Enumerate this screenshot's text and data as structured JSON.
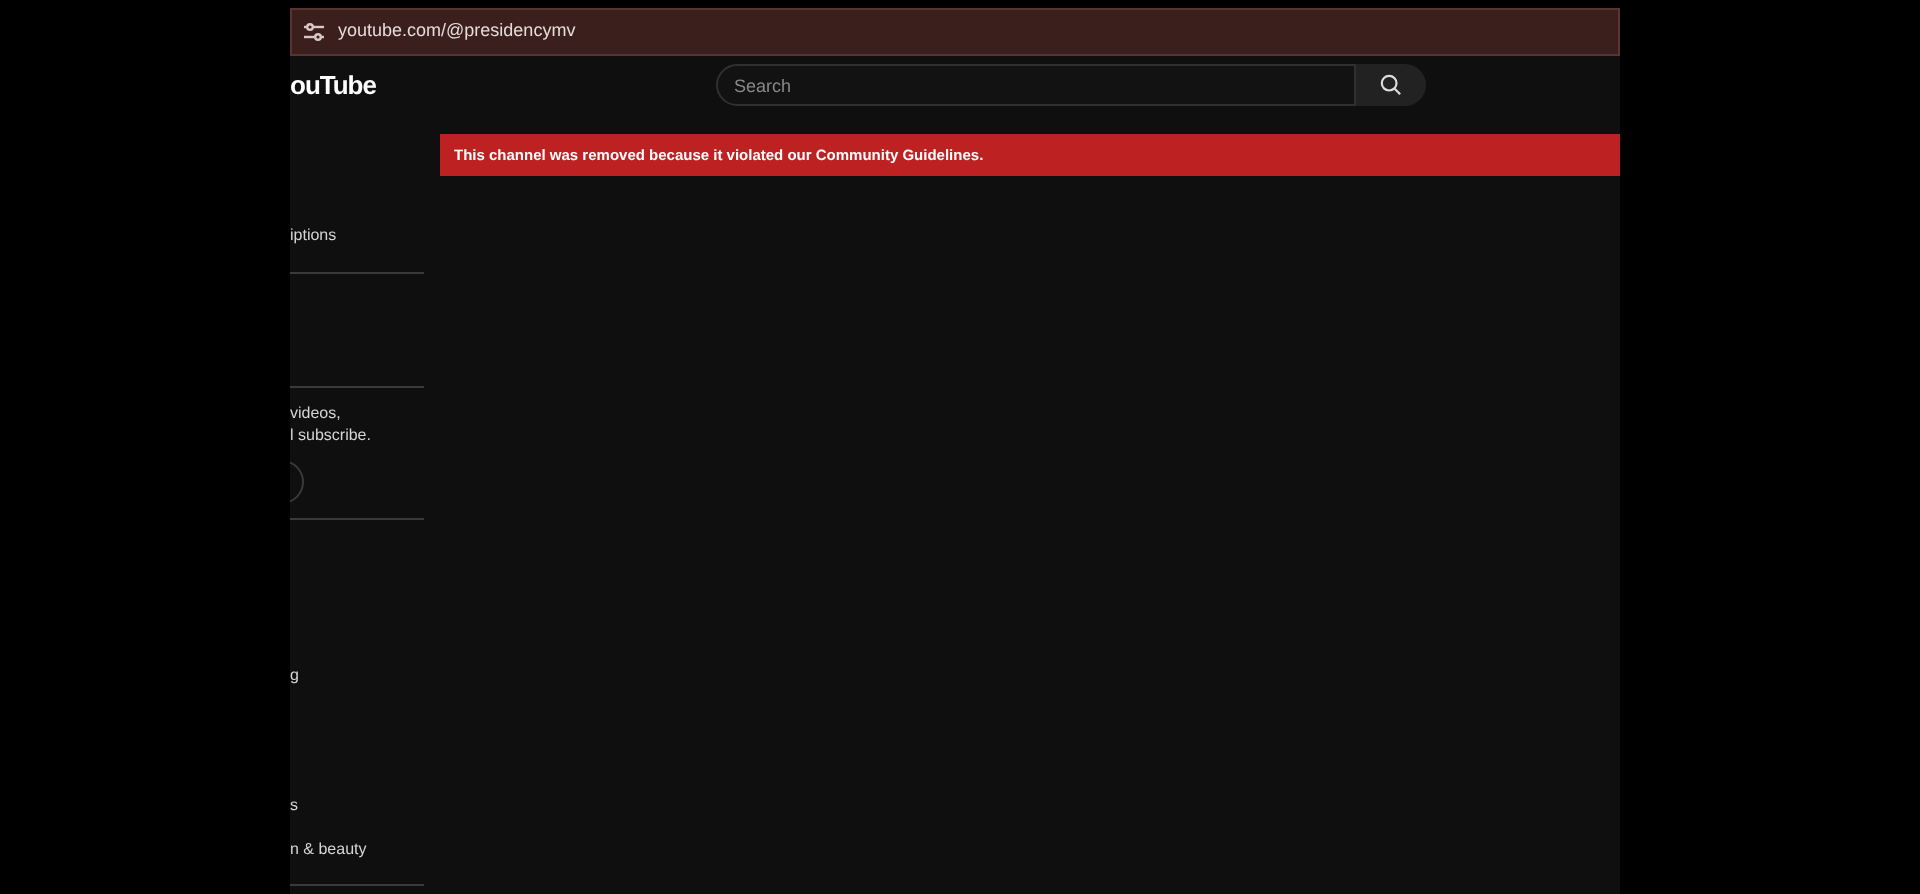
{
  "address_bar": {
    "url": "youtube.com/@presidencymv"
  },
  "header": {
    "logo": "ouTube",
    "search": {
      "placeholder": "Search"
    }
  },
  "banner": {
    "message": "This channel was removed because it violated our Community Guidelines."
  },
  "sidebar": [
    {
      "kind": "text",
      "text": "iptions"
    },
    {
      "kind": "divider"
    },
    {
      "kind": "divider"
    },
    {
      "kind": "paragraph",
      "text": "videos,\nl subscribe."
    },
    {
      "kind": "button"
    },
    {
      "kind": "divider"
    },
    {
      "kind": "text",
      "text": "g"
    },
    {
      "kind": "text",
      "text": "s"
    },
    {
      "kind": "text",
      "text": "n & beauty"
    },
    {
      "kind": "divider"
    }
  ]
}
